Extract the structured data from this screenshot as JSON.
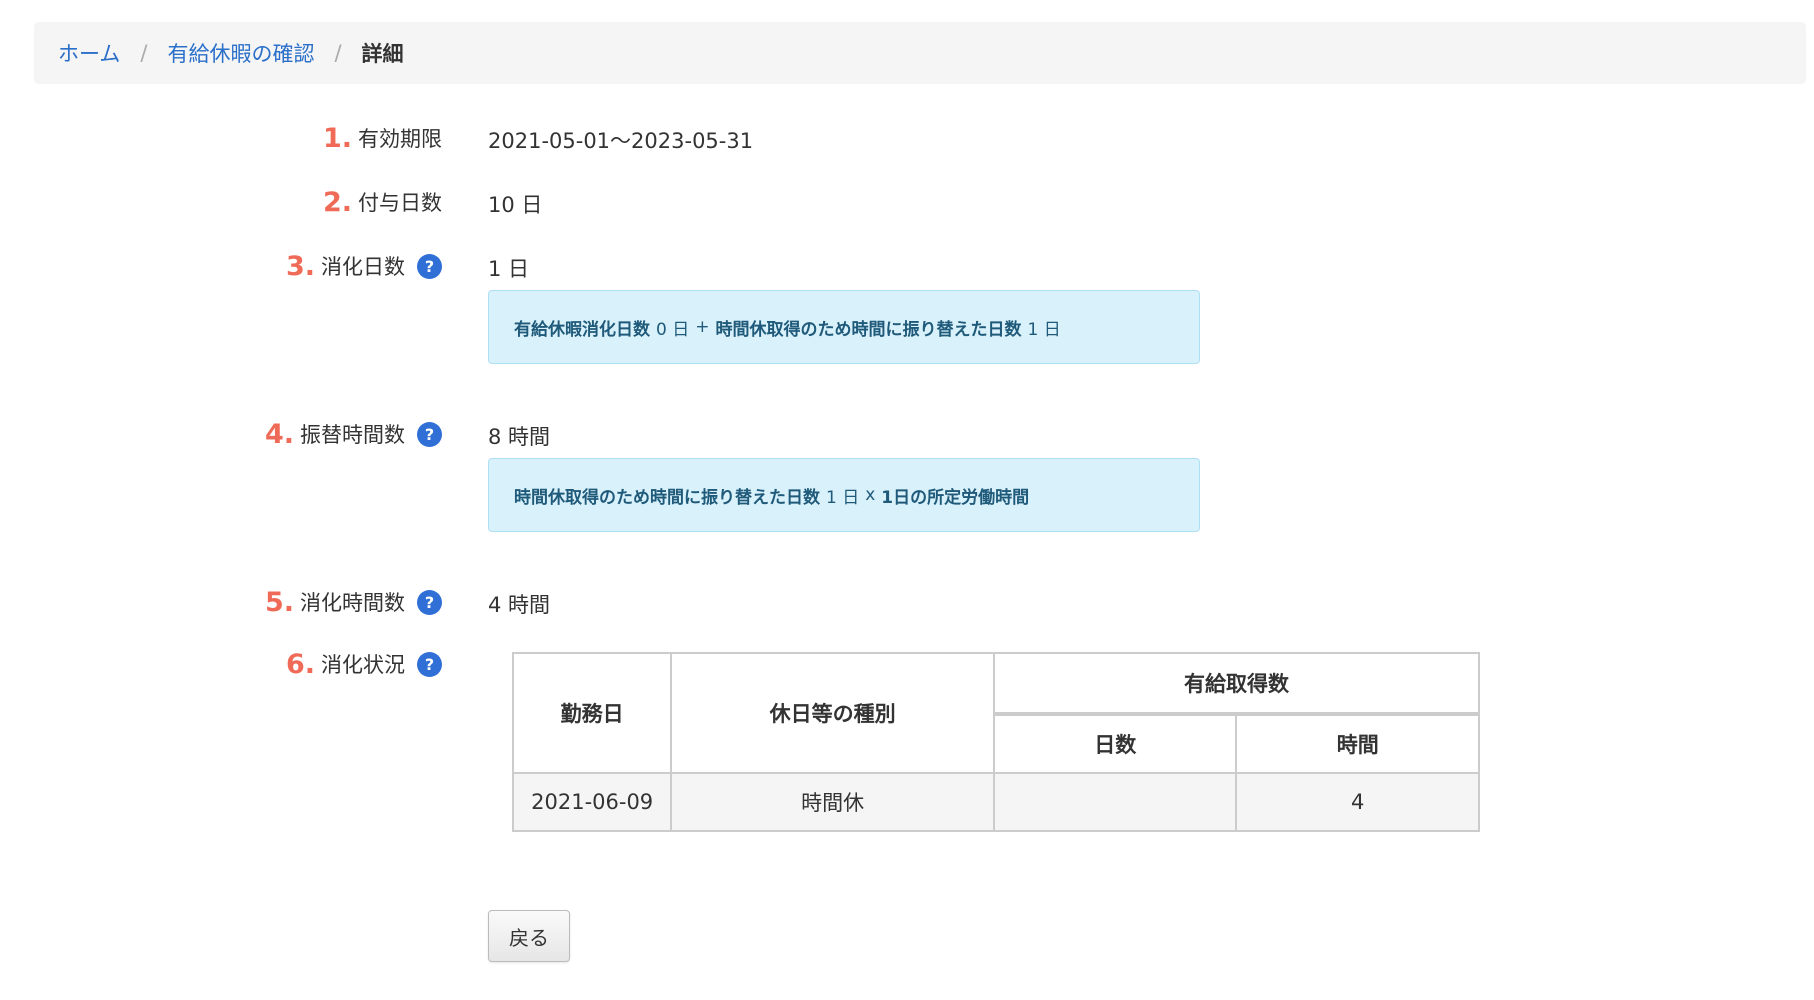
{
  "breadcrumb": {
    "home": "ホーム",
    "confirm": "有給休暇の確認",
    "separator": "/",
    "current": "詳細"
  },
  "fields": {
    "validity": {
      "num": "1.",
      "label": "有効期限",
      "value": "2021-05-01〜2023-05-31"
    },
    "granted": {
      "num": "2.",
      "label": "付与日数",
      "value": "10 日"
    },
    "consumed_days": {
      "num": "3.",
      "label": "消化日数",
      "value": "1 日",
      "info": {
        "part1": "有給休暇消化日数",
        "val1": "0 日",
        "plus": "+",
        "part2": "時間休取得のため時間に振り替えた日数",
        "val2": "1 日"
      }
    },
    "transfer_hours": {
      "num": "4.",
      "label": "振替時間数",
      "value": "8 時間",
      "info": {
        "part1": "時間休取得のため時間に振り替えた日数",
        "val1": "1 日",
        "times": "x",
        "part2": "1日の所定労働時間"
      }
    },
    "consumed_hours": {
      "num": "5.",
      "label": "消化時間数",
      "value": "4 時間"
    },
    "status": {
      "num": "6.",
      "label": "消化状況"
    }
  },
  "help_icon_glyph": "?",
  "table": {
    "headers": {
      "work_date": "勤務日",
      "holiday_type": "休日等の種別",
      "paid_taken": "有給取得数",
      "days": "日数",
      "hours": "時間"
    },
    "rows": [
      {
        "work_date": "2021-06-09",
        "holiday_type": "時間休",
        "days": "",
        "hours": "4"
      }
    ]
  },
  "back_button": "戻る",
  "colors": {
    "accent_number": "#ef6b58",
    "link": "#2a6fc9",
    "help_icon": "#2f6fd6",
    "info_bg": "#d9f1fb"
  }
}
